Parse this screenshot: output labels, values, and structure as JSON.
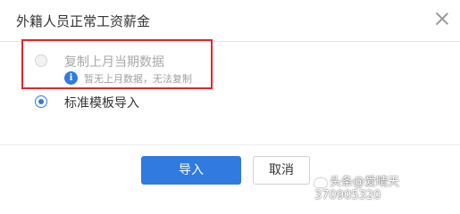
{
  "dialog": {
    "title": "外籍人员正常工资薪金"
  },
  "options": [
    {
      "label": "复制上月当期数据",
      "state": "disabled",
      "selected": false
    },
    {
      "label": "标准模板导入",
      "state": "enabled",
      "selected": true
    }
  ],
  "hint": {
    "icon": "i",
    "text": "暂无上月数据，无法复制"
  },
  "buttons": {
    "import_label": "导入",
    "cancel_label": "取消"
  },
  "watermark": {
    "text": "头条@爱晴天370905320"
  },
  "colors": {
    "primary": "#2f7be0",
    "highlight_border": "#e2262b",
    "disabled_text": "#a8a8a8"
  }
}
